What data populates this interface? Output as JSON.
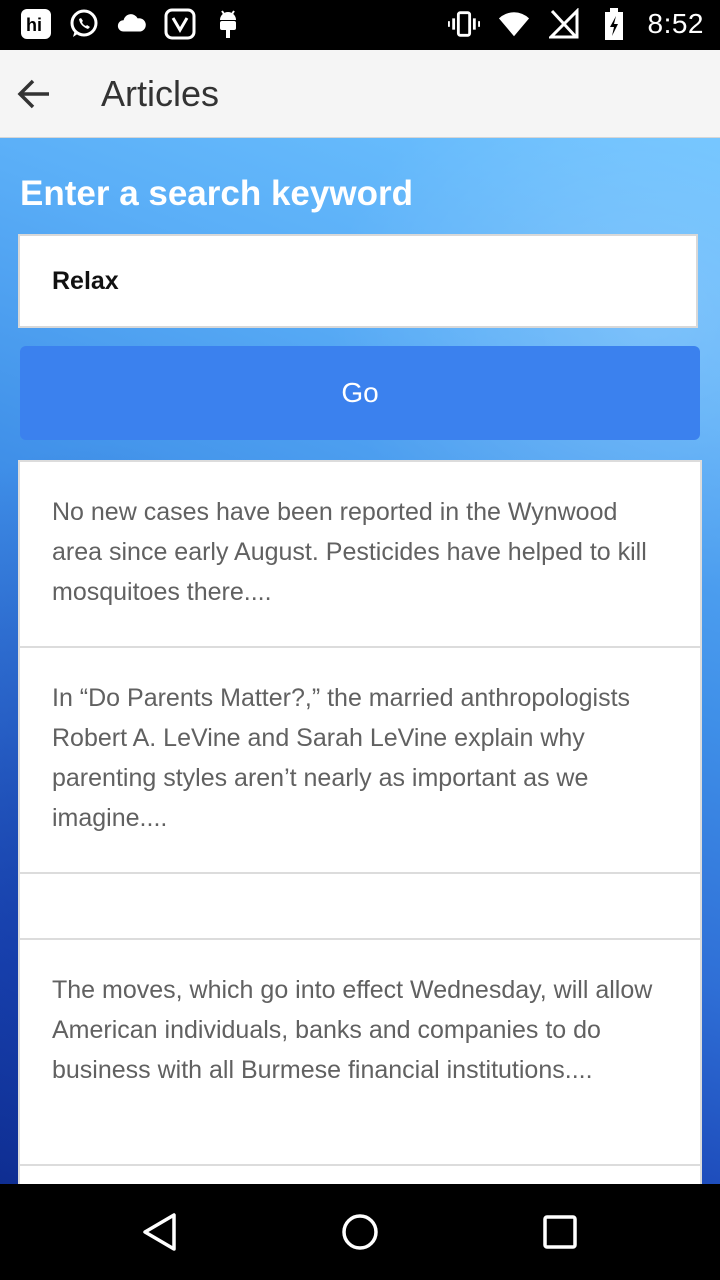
{
  "status_bar": {
    "time": "8:52",
    "left_icons": [
      "hike-icon",
      "whatsapp-icon",
      "cloud-icon",
      "saavn-icon",
      "android-icon"
    ],
    "right_icons": [
      "vibrate-icon",
      "wifi-icon",
      "no-signal-icon",
      "battery-charging-icon"
    ]
  },
  "app_bar": {
    "title": "Articles"
  },
  "search": {
    "label": "Enter a search keyword",
    "value": "Relax",
    "go_label": "Go"
  },
  "articles": [
    {
      "text": "No new cases have been reported in the Wynwood area since early August. Pesticides have helped to kill mosquitoes there...."
    },
    {
      "text": "In “Do Parents Matter?,” the married anthropologists Robert A. LeVine and Sarah LeVine explain why parenting styles aren’t nearly as important as we imagine...."
    },
    {
      "text": ""
    },
    {
      "text": "The moves, which go into effect Wednesday, will allow American individuals, banks and companies to do business with all Burmese financial institutions...."
    },
    {
      "text": ""
    }
  ],
  "colors": {
    "accent": "#3b81ee",
    "app_bar_bg": "#f5f5f5",
    "article_text": "#616161"
  }
}
